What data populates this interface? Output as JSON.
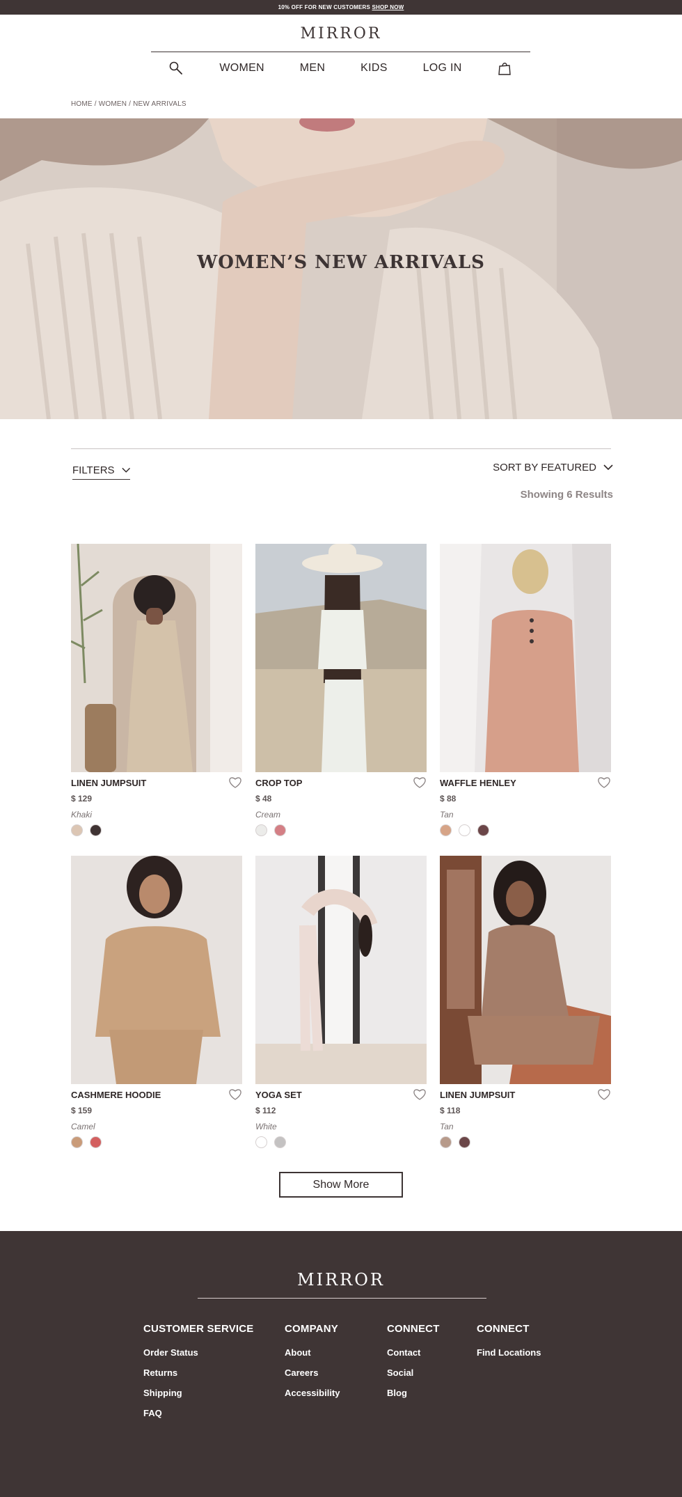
{
  "announcement": {
    "text": "10% OFF FOR NEW CUSTOMERS",
    "link": "SHOP NOW"
  },
  "brand": {
    "logo": "MIRROR"
  },
  "nav": {
    "women": "WOMEN",
    "men": "MEN",
    "kids": "KIDS",
    "login": "LOG IN",
    "search_icon": "search-icon",
    "bag_icon": "shopping-bag-icon"
  },
  "breadcrumb": "HOME / WOMEN / NEW ARRIVALS",
  "hero": {
    "title": "WOMEN’S NEW ARRIVALS"
  },
  "toolbar": {
    "filters": "FILTERS",
    "sort": "SORT BY FEATURED",
    "results": "Showing 6 Results"
  },
  "products": [
    {
      "name": "LINEN JUMPSUIT",
      "price": "$ 129",
      "color": "Khaki",
      "swatches": [
        "#dcc6b4",
        "#3f3333"
      ]
    },
    {
      "name": "CROP TOP",
      "price": "$ 48",
      "color": "Cream",
      "swatches": [
        "#ececea",
        "#d47f85"
      ]
    },
    {
      "name": "WAFFLE HENLEY",
      "price": "$ 88",
      "color": "Tan",
      "swatches": [
        "#d6a487",
        "#ffffff",
        "#6b4648"
      ]
    },
    {
      "name": "CASHMERE HOODIE",
      "price": "$ 159",
      "color": "Camel",
      "swatches": [
        "#c99b79",
        "#d35f5f"
      ]
    },
    {
      "name": "YOGA SET",
      "price": "$ 112",
      "color": "White",
      "swatches": [
        "#ffffff",
        "#c4c2c2"
      ]
    },
    {
      "name": "LINEN JUMPSUIT",
      "price": "$ 118",
      "color": "Tan",
      "swatches": [
        "#b79a8a",
        "#6b4648"
      ]
    }
  ],
  "show_more": "Show More",
  "footer": {
    "logo": "MIRROR",
    "columns": [
      {
        "title": "CUSTOMER SERVICE",
        "links": [
          "Order Status",
          "Returns",
          "Shipping",
          "FAQ"
        ]
      },
      {
        "title": "COMPANY",
        "links": [
          "About",
          "Careers",
          "Accessibility"
        ]
      },
      {
        "title": "CONNECT",
        "links": [
          "Contact",
          "Social",
          "Blog"
        ]
      },
      {
        "title": "CONNECT",
        "links": [
          "Find Locations"
        ]
      }
    ]
  },
  "colors": {
    "brand_dark": "#3f3535",
    "text": "#2f2727",
    "muted": "#8d8585"
  }
}
